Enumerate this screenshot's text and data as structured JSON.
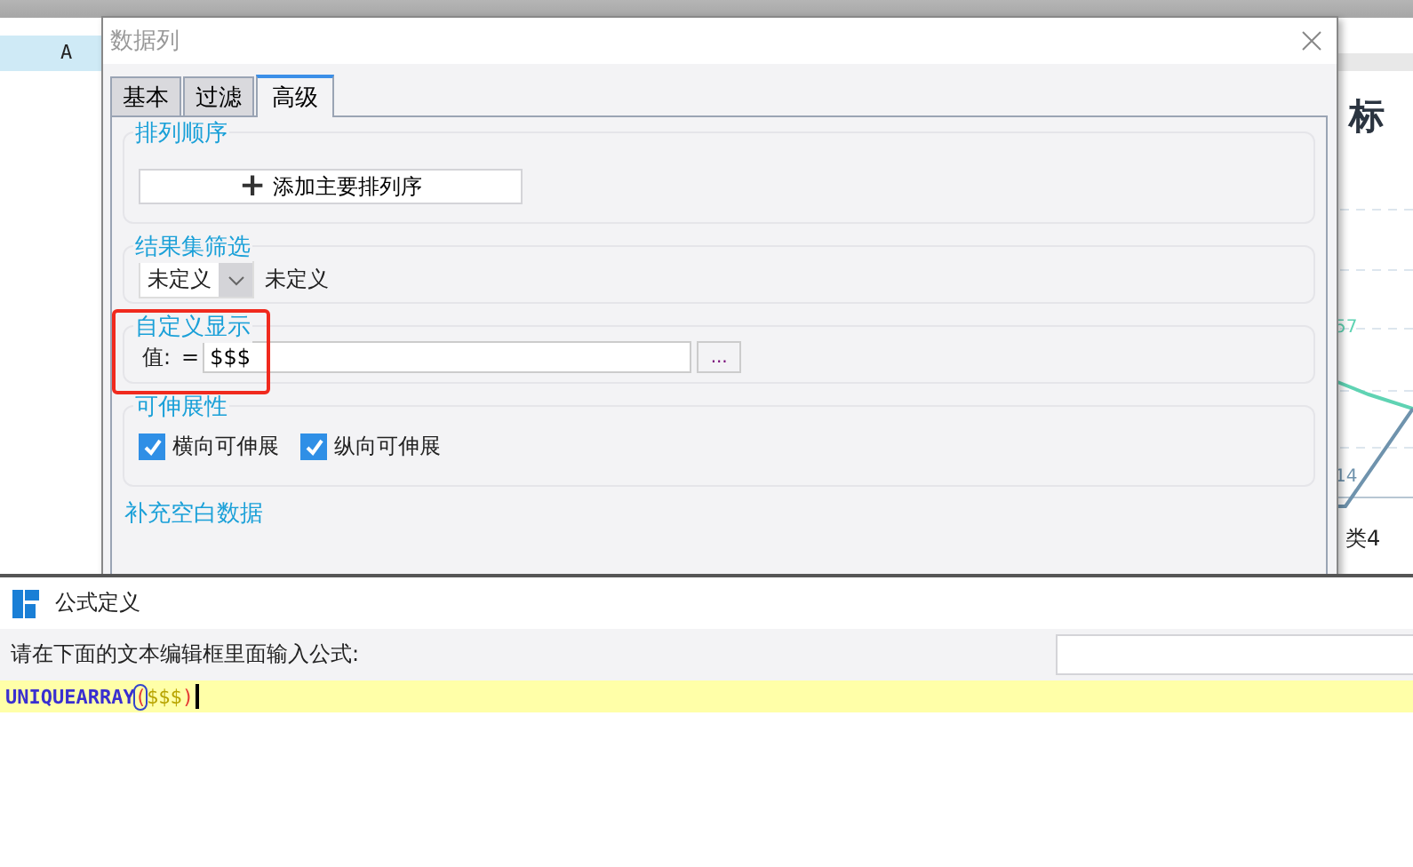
{
  "sheet": {
    "column_header": "A"
  },
  "chart": {
    "title": "标",
    "point_labels": [
      {
        "text": "57",
        "color": "#5fd3b3"
      },
      {
        "text": "14",
        "color": "#6f93ad"
      }
    ],
    "category": "类4"
  },
  "dialog": {
    "title": "数据列",
    "tabs": [
      {
        "label": "基本",
        "selected": false
      },
      {
        "label": "过滤",
        "selected": false
      },
      {
        "label": "高级",
        "selected": true
      }
    ],
    "sort": {
      "legend": "排列顺序",
      "button": "添加主要排列序",
      "button_icon": "+"
    },
    "filter": {
      "legend": "结果集筛选",
      "dropdown_value": "未定义",
      "description": "未定义"
    },
    "custom_display": {
      "legend": "自定义显示",
      "highlighted": true,
      "label": "值:",
      "equals": "=",
      "value": "$$$",
      "more_button": "..."
    },
    "stretch": {
      "legend": "可伸展性",
      "options": [
        {
          "label": "横向可伸展",
          "checked": true
        },
        {
          "label": "纵向可伸展",
          "checked": true
        }
      ]
    },
    "next_section": "补充空白数据"
  },
  "formula_window": {
    "title": "公式定义",
    "prompt": "请在下面的文本编辑框里面输入公式:",
    "tokens": [
      {
        "text": "UNIQUEARRAY",
        "kind": "function",
        "matched": false
      },
      {
        "text": "(",
        "kind": "paren",
        "matched": true
      },
      {
        "text": "$$$",
        "kind": "param",
        "matched": false
      },
      {
        "text": ")",
        "kind": "paren",
        "matched": false
      }
    ]
  }
}
